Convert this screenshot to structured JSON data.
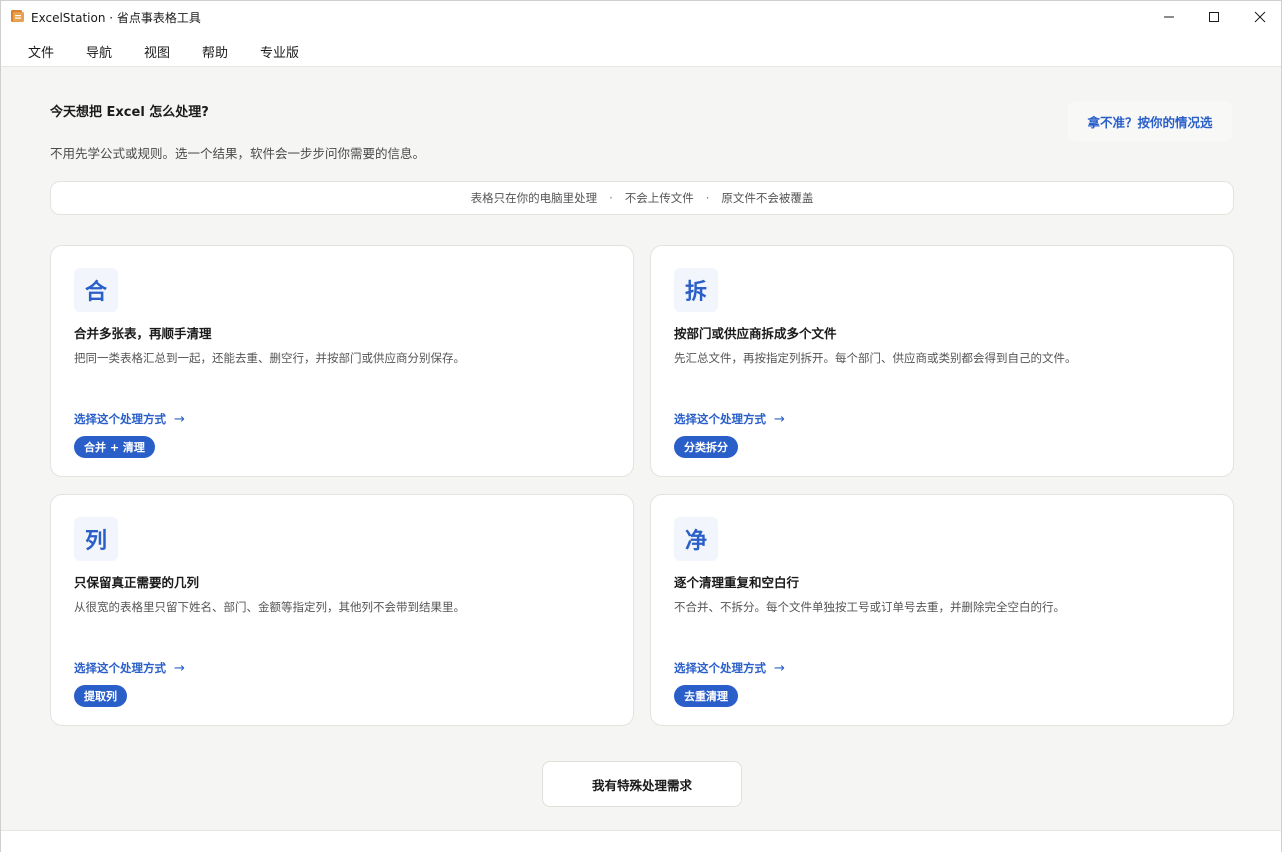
{
  "window": {
    "title": "ExcelStation · 省点事表格工具",
    "controls": [
      "minimize-icon",
      "maximize-icon",
      "close-icon"
    ]
  },
  "menu": {
    "items": [
      {
        "label": "文件"
      },
      {
        "label": "导航"
      },
      {
        "label": "视图"
      },
      {
        "label": "帮助"
      },
      {
        "label": "专业版"
      }
    ]
  },
  "header": {
    "heading": "今天想把 Excel 怎么处理?",
    "subtext": "不用先学公式或规则。选一个结果，软件会一步步问你需要的信息。",
    "help_button": "拿不准？按你的情况选"
  },
  "privacy": {
    "items": [
      "表格只在你的电脑里处理",
      "不会上传文件",
      "原文件不会被覆盖"
    ],
    "separator": "·"
  },
  "cards": [
    {
      "icon_char": "合",
      "title": "合并多张表，再顺手清理",
      "desc": "把同一类表格汇总到一起，还能去重、删空行，并按部门或供应商分别保存。",
      "link": "选择这个处理方式",
      "tag": "合并 + 清理"
    },
    {
      "icon_char": "拆",
      "title": "按部门或供应商拆成多个文件",
      "desc": "先汇总文件，再按指定列拆开。每个部门、供应商或类别都会得到自己的文件。",
      "link": "选择这个处理方式",
      "tag": "分类拆分"
    },
    {
      "icon_char": "列",
      "title": "只保留真正需要的几列",
      "desc": "从很宽的表格里只留下姓名、部门、金额等指定列，其他列不会带到结果里。",
      "link": "选择这个处理方式",
      "tag": "提取列"
    },
    {
      "icon_char": "净",
      "title": "逐个清理重复和空白行",
      "desc": "不合并、不拆分。每个文件单独按工号或订单号去重，并删除完全空白的行。",
      "link": "选择这个处理方式",
      "tag": "去重清理"
    }
  ],
  "link_arrow": "→",
  "special_button": "我有特殊处理需求",
  "colors": {
    "accent": "#2a5fc9",
    "background": "#f5f5f3",
    "card": "#ffffff"
  }
}
